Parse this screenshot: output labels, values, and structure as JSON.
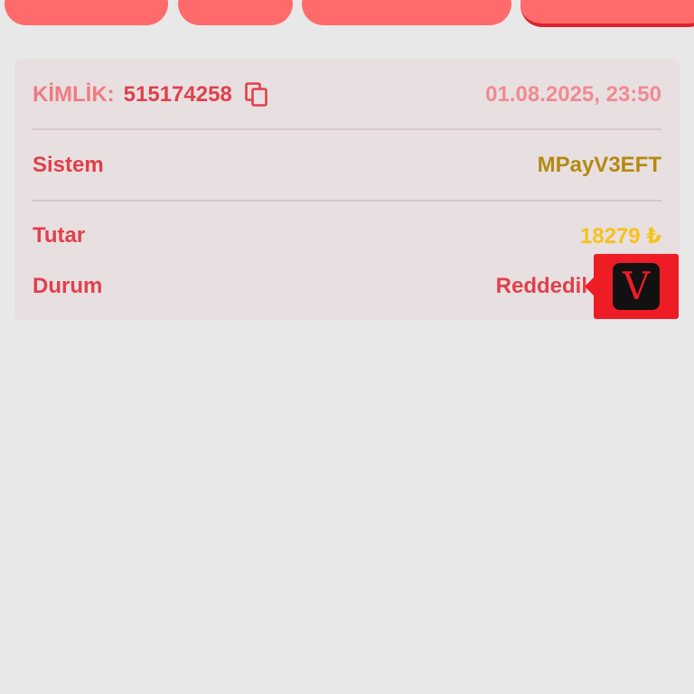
{
  "tabs": [
    {
      "label": ""
    },
    {
      "label": ""
    },
    {
      "label": ""
    },
    {
      "label": ""
    }
  ],
  "transaction": {
    "id_label": "KİMLİK:",
    "id_value": "515174258",
    "datetime": "01.08.2025, 23:50",
    "system_label": "Sistem",
    "system_value": "MPayV3EFT",
    "amount_label": "Tutar",
    "amount_value": "18279 ₺",
    "status_label": "Durum",
    "status_value": "Reddedil"
  },
  "badge": {
    "letter": "V"
  },
  "colors": {
    "background": "#e8e8e8",
    "tab": "#ff6b6b",
    "card": "#e8dfe0",
    "label_red": "#e0404c",
    "id_label": "#f07b83",
    "system_gold": "#b38a12",
    "amount_yellow": "#f7c21c",
    "badge_red": "#ee1c25"
  },
  "icons": {
    "copy": "copy-icon"
  }
}
